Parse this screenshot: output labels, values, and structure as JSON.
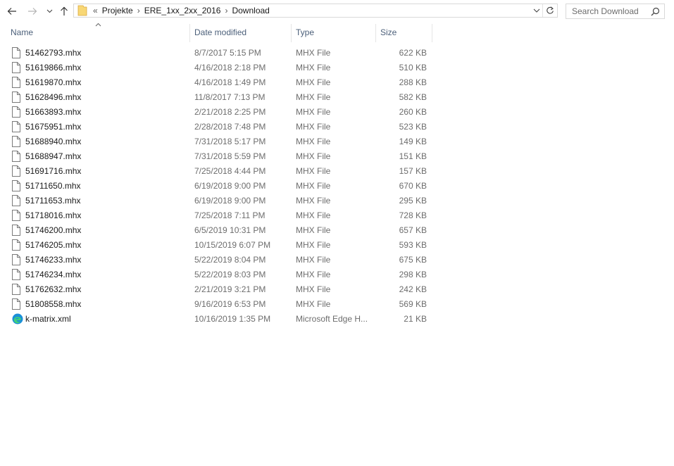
{
  "nav": {
    "back_icon": "back-arrow-icon",
    "forward_icon": "forward-arrow-icon",
    "recent_icon": "chevron-down-icon",
    "up_icon": "up-arrow-icon"
  },
  "address": {
    "overflow": "«",
    "crumbs": [
      "Projekte",
      "ERE_1xx_2xx_2016",
      "Download"
    ],
    "separator": "›"
  },
  "search": {
    "placeholder": "Search Download"
  },
  "columns": {
    "name": "Name",
    "date": "Date modified",
    "type": "Type",
    "size": "Size"
  },
  "files": [
    {
      "name": "51462793.mhx",
      "date": "8/7/2017 5:15 PM",
      "type": "MHX File",
      "size": "622 KB",
      "icon": "file-icon"
    },
    {
      "name": "51619866.mhx",
      "date": "4/16/2018 2:18 PM",
      "type": "MHX File",
      "size": "510 KB",
      "icon": "file-icon"
    },
    {
      "name": "51619870.mhx",
      "date": "4/16/2018 1:49 PM",
      "type": "MHX File",
      "size": "288 KB",
      "icon": "file-icon"
    },
    {
      "name": "51628496.mhx",
      "date": "11/8/2017 7:13 PM",
      "type": "MHX File",
      "size": "582 KB",
      "icon": "file-icon"
    },
    {
      "name": "51663893.mhx",
      "date": "2/21/2018 2:25 PM",
      "type": "MHX File",
      "size": "260 KB",
      "icon": "file-icon"
    },
    {
      "name": "51675951.mhx",
      "date": "2/28/2018 7:48 PM",
      "type": "MHX File",
      "size": "523 KB",
      "icon": "file-icon"
    },
    {
      "name": "51688940.mhx",
      "date": "7/31/2018 5:17 PM",
      "type": "MHX File",
      "size": "149 KB",
      "icon": "file-icon"
    },
    {
      "name": "51688947.mhx",
      "date": "7/31/2018 5:59 PM",
      "type": "MHX File",
      "size": "151 KB",
      "icon": "file-icon"
    },
    {
      "name": "51691716.mhx",
      "date": "7/25/2018 4:44 PM",
      "type": "MHX File",
      "size": "157 KB",
      "icon": "file-icon"
    },
    {
      "name": "51711650.mhx",
      "date": "6/19/2018 9:00 PM",
      "type": "MHX File",
      "size": "670 KB",
      "icon": "file-icon"
    },
    {
      "name": "51711653.mhx",
      "date": "6/19/2018 9:00 PM",
      "type": "MHX File",
      "size": "295 KB",
      "icon": "file-icon"
    },
    {
      "name": "51718016.mhx",
      "date": "7/25/2018 7:11 PM",
      "type": "MHX File",
      "size": "728 KB",
      "icon": "file-icon"
    },
    {
      "name": "51746200.mhx",
      "date": "6/5/2019 10:31 PM",
      "type": "MHX File",
      "size": "657 KB",
      "icon": "file-icon"
    },
    {
      "name": "51746205.mhx",
      "date": "10/15/2019 6:07 PM",
      "type": "MHX File",
      "size": "593 KB",
      "icon": "file-icon"
    },
    {
      "name": "51746233.mhx",
      "date": "5/22/2019 8:04 PM",
      "type": "MHX File",
      "size": "675 KB",
      "icon": "file-icon"
    },
    {
      "name": "51746234.mhx",
      "date": "5/22/2019 8:03 PM",
      "type": "MHX File",
      "size": "298 KB",
      "icon": "file-icon"
    },
    {
      "name": "51762632.mhx",
      "date": "2/21/2019 3:21 PM",
      "type": "MHX File",
      "size": "242 KB",
      "icon": "file-icon"
    },
    {
      "name": "51808558.mhx",
      "date": "9/16/2019 6:53 PM",
      "type": "MHX File",
      "size": "569 KB",
      "icon": "file-icon"
    },
    {
      "name": "k-matrix.xml",
      "date": "10/16/2019 1:35 PM",
      "type": "Microsoft Edge H...",
      "size": "21 KB",
      "icon": "edge-icon"
    }
  ],
  "colors": {
    "header_text": "#4c607a",
    "detail_text": "#6d6d6d",
    "folder": "#f8d775",
    "border": "#d9d9d9"
  }
}
